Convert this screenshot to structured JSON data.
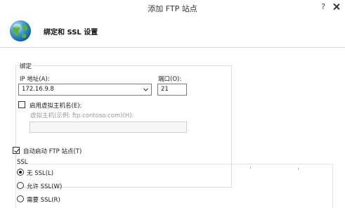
{
  "window": {
    "title": "添加 FTP 站点",
    "help_label": "?"
  },
  "header": {
    "heading": "绑定和 SSL 设置"
  },
  "binding": {
    "group_label": "绑定",
    "ip_label": "IP 地址(A):",
    "ip_value": "172.16.9.8",
    "port_label": "端口(O):",
    "port_value": "21",
    "virtual_host_checkbox_label": "启用虚拟主机名(E):",
    "virtual_host_checked": false,
    "virtual_host_hint": "虚拟主机(示例: ftp.contoso.com)(H):",
    "virtual_host_value": ""
  },
  "autostart": {
    "label": "自动启动 FTP 站点(T)",
    "checked": true
  },
  "ssl": {
    "group_label": "SSL",
    "options": [
      {
        "label": "无 SSL(L)",
        "selected": true
      },
      {
        "label": "允许 SSL(W)",
        "selected": false
      },
      {
        "label": "需要 SSL(R)",
        "selected": false
      }
    ]
  }
}
